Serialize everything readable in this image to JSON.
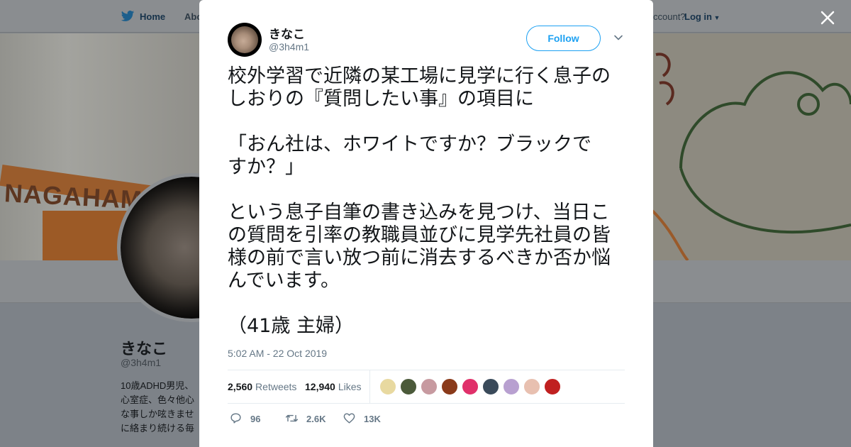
{
  "topnav": {
    "home_label": "Home",
    "about_label": "Abo",
    "account_prompt": "ccount?",
    "login_label": "Log in"
  },
  "banner": {
    "cup_text": "NAGAHAMA"
  },
  "profile": {
    "name": "きなこ",
    "handle": "@3h4m1",
    "bio_lines": [
      "10歳ADHD男児、",
      "心室症、色々他心",
      "な事しか呟きませ",
      "に絡まり続ける毎"
    ]
  },
  "tweet": {
    "author_name": "きなこ",
    "author_handle": "@3h4m1",
    "follow_label": "Follow",
    "paragraphs": [
      [
        "校外学習で近隣の某工場に見学に行く息子の",
        "しおりの『質問したい事』の項目に"
      ],
      [
        "「おん社は、ホワイトですか？ブラックで",
        "すか？」"
      ],
      [
        "という息子自筆の書き込みを見つけ、当日こ",
        "の質問を引率の教職員並びに見学先社員の皆",
        "様の前で言い放つ前に消去するべきか否か悩",
        "んでいます。"
      ],
      [
        "（41歳 主婦）"
      ]
    ],
    "timestamp": "5:02 AM - 22 Oct 2019",
    "retweets_count": "2,560",
    "retweets_label": "Retweets",
    "likes_count": "12,940",
    "likes_label": "Likes",
    "liker_avatar_colors": [
      "#e8d9a0",
      "#4b5a3a",
      "#c79aa0",
      "#8a3a1a",
      "#e0306a",
      "#3a4a5a",
      "#b8a0d0",
      "#e8c0b0",
      "#c02020"
    ],
    "actions": {
      "reply_count": "96",
      "retweet_count": "2.6K",
      "like_count": "13K"
    }
  },
  "colors": {
    "accent": "#1da1f2",
    "muted": "#657786",
    "text": "#14171a"
  }
}
